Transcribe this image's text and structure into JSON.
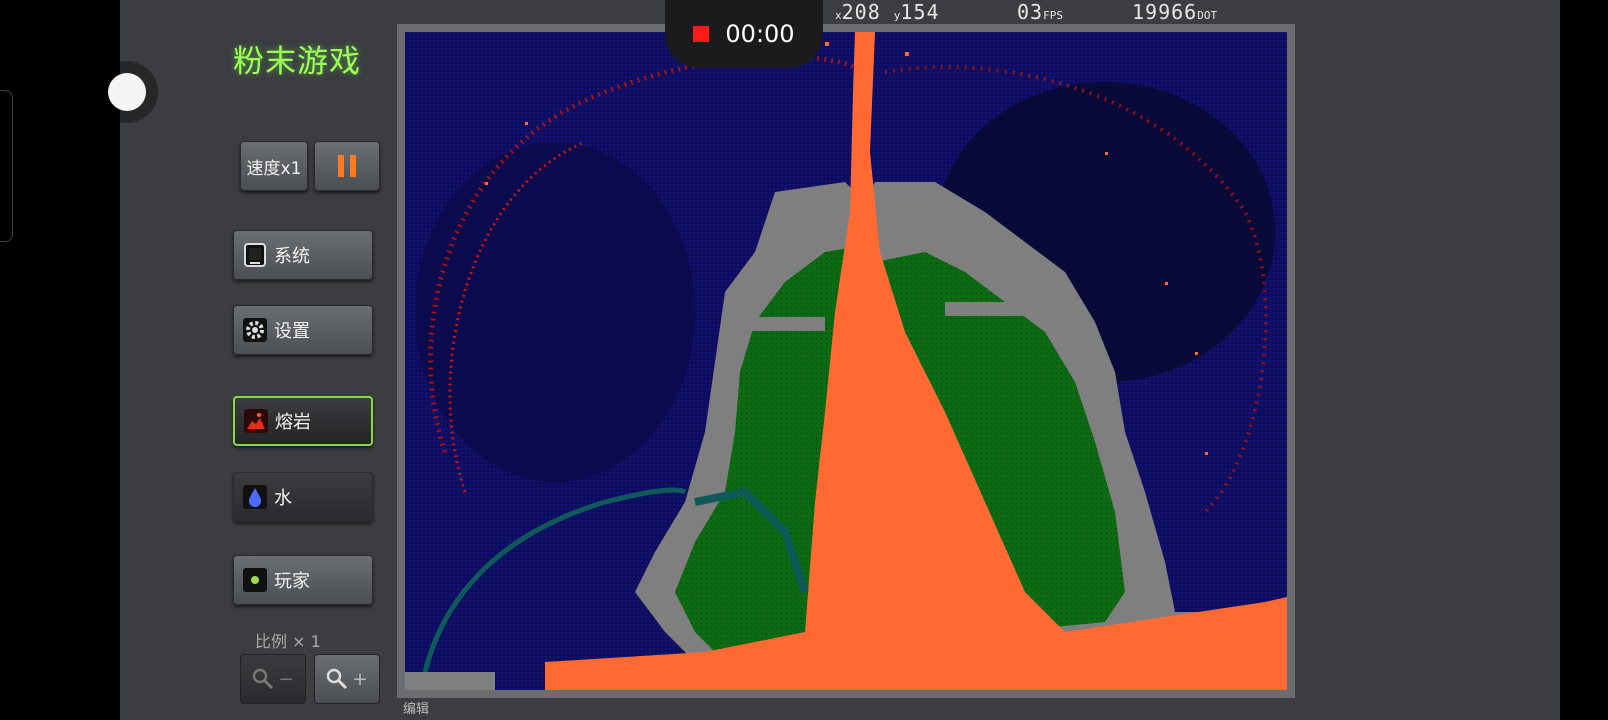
{
  "app": {
    "title": "粉末游戏"
  },
  "recorder": {
    "time": "00:00"
  },
  "hud": {
    "x_label": "x",
    "x_value": "208",
    "y_label": "y",
    "y_value": "154",
    "fps_value": "03",
    "fps_unit": "FPS",
    "dot_value": "19966",
    "dot_unit": "DOT"
  },
  "toolbar": {
    "speed_label": "速度x1",
    "system_label": "系统",
    "settings_label": "设置",
    "lava_label": "熔岩",
    "water_label": "水",
    "player_label": "玩家",
    "scale_label": "比例 × 1",
    "zoom_out_label": "−",
    "zoom_in_label": "+"
  },
  "canvas": {
    "edit_label": "编辑"
  },
  "colors": {
    "background": "#0d0d5c",
    "lava": "#ff6a33",
    "plant": "#0b6a12",
    "wall": "#7f7f7f",
    "fire": "#b3120c",
    "accent": "#9dff55"
  },
  "icons": {
    "system": "tablet-icon",
    "settings": "gear-icon",
    "lava": "lava-icon",
    "water": "water-drop-icon",
    "player": "player-dot-icon",
    "zoom": "magnifier-icon",
    "pause": "pause-icon"
  }
}
